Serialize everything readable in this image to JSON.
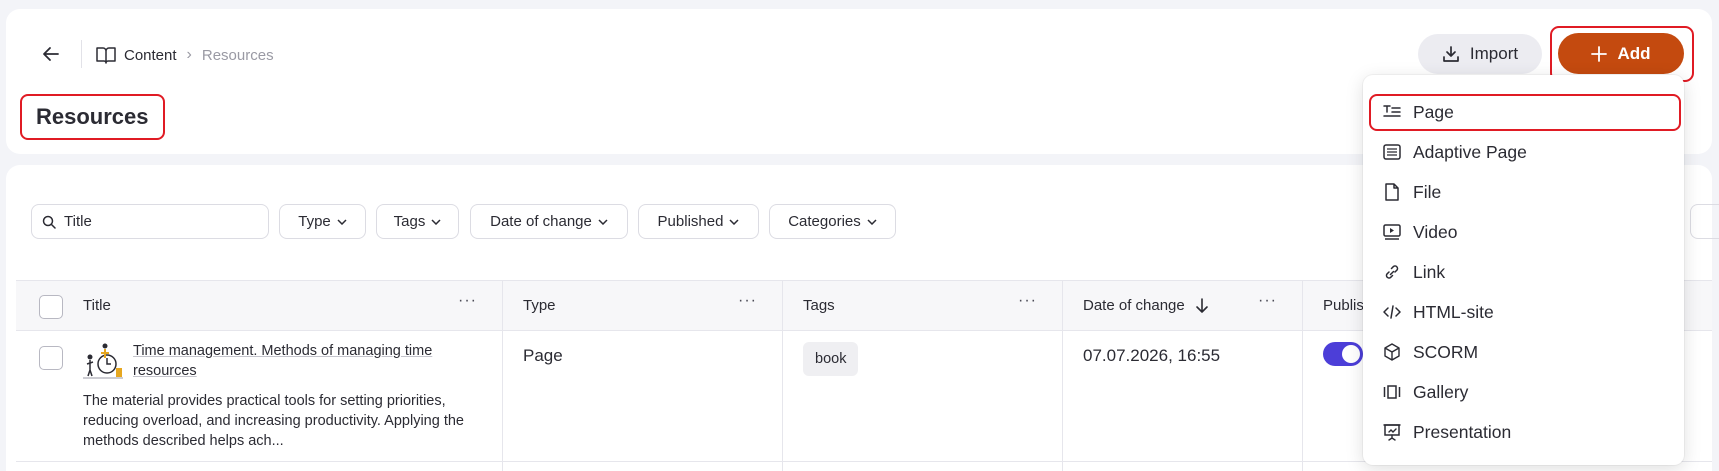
{
  "header": {
    "breadcrumb": {
      "content": "Content",
      "current": "Resources"
    },
    "title": "Resources",
    "import_label": "Import",
    "add_label": "Add"
  },
  "filters": {
    "search_placeholder": "Title",
    "type": "Type",
    "tags": "Tags",
    "date": "Date of change",
    "published": "Published",
    "categories": "Categories"
  },
  "table": {
    "columns": [
      "Title",
      "Type",
      "Tags",
      "Date of change",
      "Publis"
    ],
    "rows": [
      {
        "title": "Time management. Methods of managing time resources",
        "description": "The material provides practical tools for setting priorities, reducing overload, and increasing productivity. Applying the methods described helps ach...",
        "type": "Page",
        "tag": "book",
        "date": "07.07.2026, 16:55",
        "published": true
      }
    ]
  },
  "add_menu": {
    "items": [
      {
        "label": "Page",
        "icon": "page-icon"
      },
      {
        "label": "Adaptive Page",
        "icon": "adaptive-page-icon"
      },
      {
        "label": "File",
        "icon": "file-icon"
      },
      {
        "label": "Video",
        "icon": "video-icon"
      },
      {
        "label": "Link",
        "icon": "link-icon"
      },
      {
        "label": "HTML-site",
        "icon": "code-icon"
      },
      {
        "label": "SCORM",
        "icon": "cube-icon"
      },
      {
        "label": "Gallery",
        "icon": "gallery-icon"
      },
      {
        "label": "Presentation",
        "icon": "presentation-icon"
      }
    ]
  },
  "colors": {
    "accent": "#c44a0f",
    "highlight": "#e01b24",
    "toggle": "#4c3ed8"
  }
}
